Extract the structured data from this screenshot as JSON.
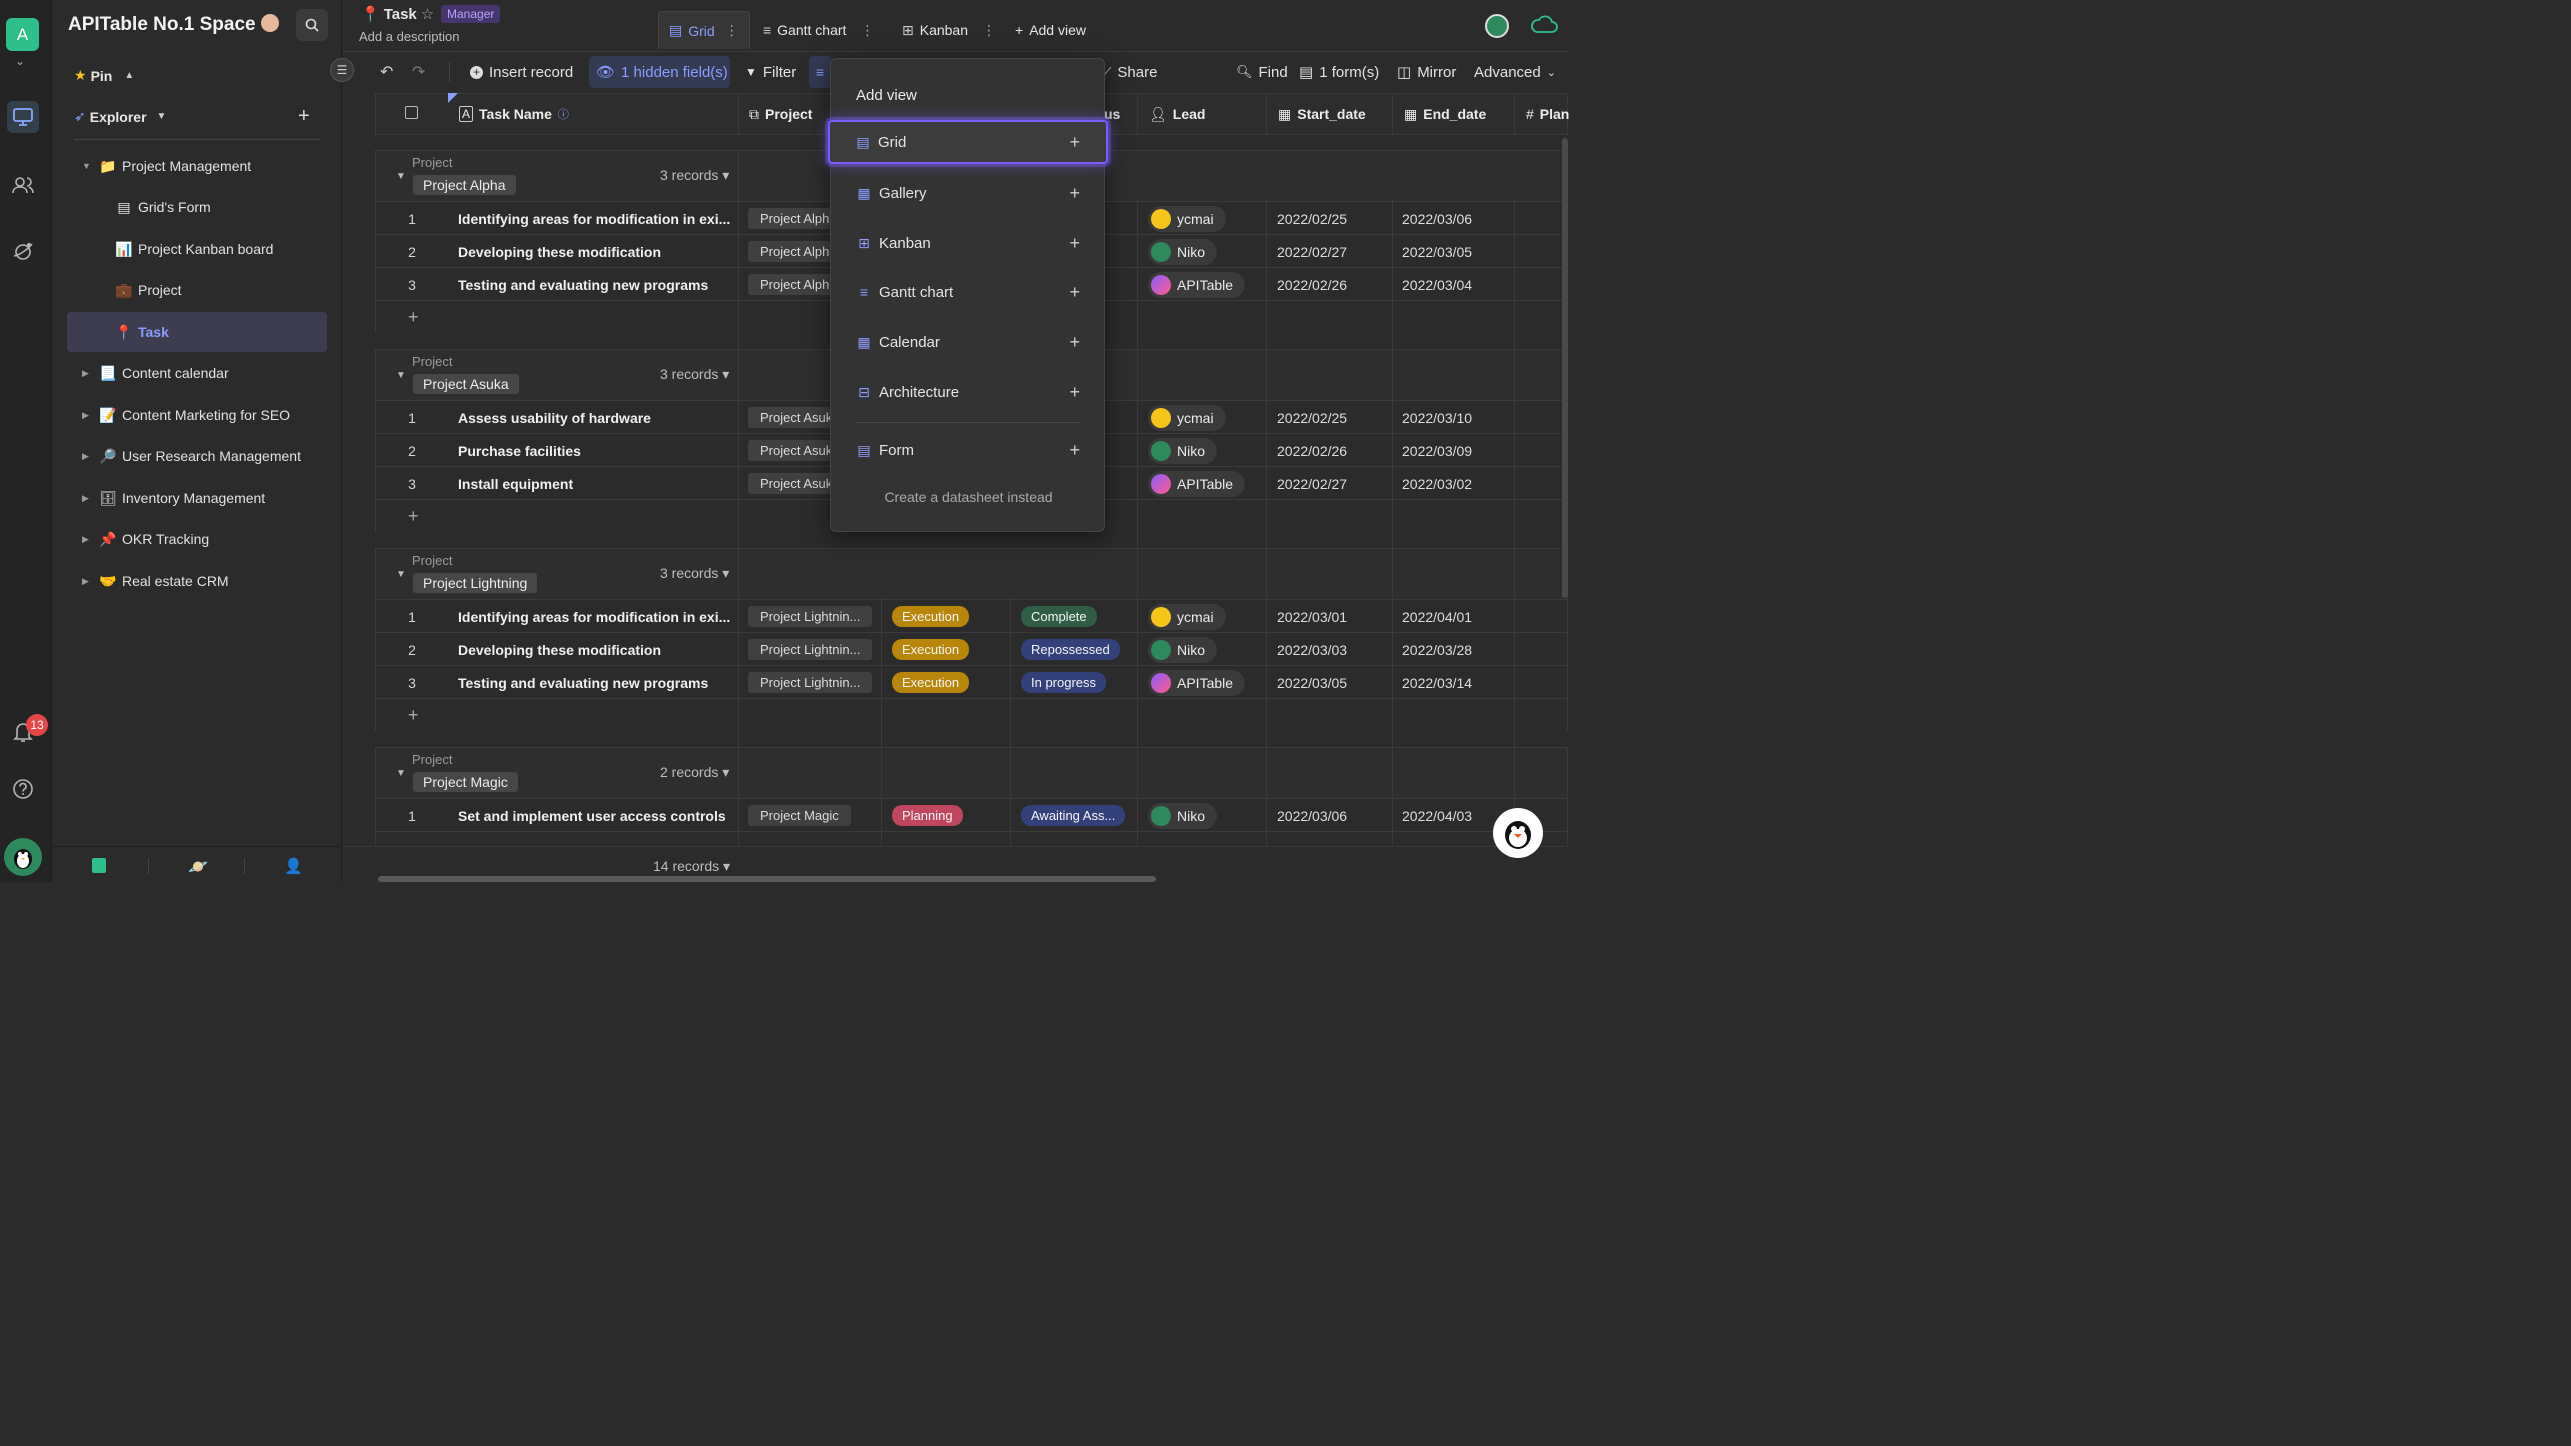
{
  "space": {
    "avatar_letter": "A",
    "name": "APITable No.1 Space",
    "notification_count": "13"
  },
  "sidebar": {
    "pin_label": "Pin",
    "explorer_label": "Explorer",
    "items": [
      {
        "label": "Project Management",
        "icon": "📁"
      },
      {
        "label": "Grid's Form",
        "icon": "▤"
      },
      {
        "label": "Project Kanban board",
        "icon": "📊"
      },
      {
        "label": "Project",
        "icon": "💼"
      },
      {
        "label": "Task",
        "icon": "📍"
      },
      {
        "label": "Content calendar",
        "icon": "📃"
      },
      {
        "label": "Content Marketing for SEO",
        "icon": "📝"
      },
      {
        "label": "User Research Management",
        "icon": "🔎"
      },
      {
        "label": "Inventory Management",
        "icon": "🗄"
      },
      {
        "label": "OKR Tracking",
        "icon": "📌"
      },
      {
        "label": "Real estate CRM",
        "icon": "🤝"
      }
    ]
  },
  "datasheet": {
    "title": "Task",
    "role": "Manager",
    "description": "Add a description",
    "views": [
      {
        "label": "Grid"
      },
      {
        "label": "Gantt chart"
      },
      {
        "label": "Kanban"
      }
    ],
    "add_view_label": "Add view"
  },
  "toolbar": {
    "insert_record": "Insert record",
    "hidden_fields": "1 hidden field(s)",
    "filter": "Filter",
    "share": "Share",
    "find": "Find",
    "forms": "1 form(s)",
    "mirror": "Mirror",
    "advanced": "Advanced"
  },
  "columns": {
    "task_name": "Task Name",
    "project": "Project",
    "status_partial": "us",
    "lead": "Lead",
    "start_date": "Start_date",
    "end_date": "End_date",
    "plan_partial": "Plan"
  },
  "groups": [
    {
      "label": "Project",
      "name": "Project Alpha",
      "count": "3 records",
      "rows": [
        {
          "n": "1",
          "task": "Identifying areas for modification in exi...",
          "project": "Project Alph",
          "phase": "",
          "status": "",
          "lead": "ycmai",
          "start": "2022/02/25",
          "end": "2022/03/06"
        },
        {
          "n": "2",
          "task": "Developing these modification",
          "project": "Project Alph",
          "phase": "",
          "status": "",
          "lead": "Niko",
          "start": "2022/02/27",
          "end": "2022/03/05"
        },
        {
          "n": "3",
          "task": "Testing and evaluating new programs",
          "project": "Project Alph",
          "phase": "",
          "status": "",
          "lead": "APITable",
          "start": "2022/02/26",
          "end": "2022/03/04"
        }
      ]
    },
    {
      "label": "Project",
      "name": "Project Asuka",
      "count": "3 records",
      "rows": [
        {
          "n": "1",
          "task": "Assess usability of hardware",
          "project": "Project Asuk",
          "phase": "",
          "status": "",
          "lead": "ycmai",
          "start": "2022/02/25",
          "end": "2022/03/10"
        },
        {
          "n": "2",
          "task": "Purchase facilities",
          "project": "Project Asuk",
          "phase": "",
          "status": "",
          "lead": "Niko",
          "start": "2022/02/26",
          "end": "2022/03/09"
        },
        {
          "n": "3",
          "task": "Install equipment",
          "project": "Project Asuk",
          "phase": "",
          "status": "",
          "lead": "APITable",
          "start": "2022/02/27",
          "end": "2022/03/02"
        }
      ]
    },
    {
      "label": "Project",
      "name": "Project Lightning",
      "count": "3 records",
      "rows": [
        {
          "n": "1",
          "task": "Identifying areas for modification in exi...",
          "project": "Project Lightnin...",
          "phase": "Execution",
          "status": "Complete",
          "lead": "ycmai",
          "start": "2022/03/01",
          "end": "2022/04/01"
        },
        {
          "n": "2",
          "task": "Developing these modification",
          "project": "Project Lightnin...",
          "phase": "Execution",
          "status": "Repossessed",
          "lead": "Niko",
          "start": "2022/03/03",
          "end": "2022/03/28"
        },
        {
          "n": "3",
          "task": "Testing and evaluating new programs",
          "project": "Project Lightnin...",
          "phase": "Execution",
          "status": "In progress",
          "lead": "APITable",
          "start": "2022/03/05",
          "end": "2022/03/14"
        }
      ]
    },
    {
      "label": "Project",
      "name": "Project Magic",
      "count": "2 records",
      "rows": [
        {
          "n": "1",
          "task": "Set and implement user access controls",
          "project": "Project Magic",
          "phase": "Planning",
          "status": "Awaiting Ass...",
          "lead": "Niko",
          "start": "2022/03/06",
          "end": "2022/04/03"
        }
      ]
    }
  ],
  "footer": {
    "records": "14 records"
  },
  "add_view_menu": {
    "title": "Add view",
    "items": [
      {
        "label": "Grid",
        "icon": "grid-icon"
      },
      {
        "label": "Gallery",
        "icon": "gallery-icon"
      },
      {
        "label": "Kanban",
        "icon": "kanban-icon"
      },
      {
        "label": "Gantt chart",
        "icon": "gantt-icon"
      },
      {
        "label": "Calendar",
        "icon": "calendar-icon"
      },
      {
        "label": "Architecture",
        "icon": "architecture-icon"
      },
      {
        "label": "Form",
        "icon": "form-icon"
      }
    ],
    "footer": "Create a datasheet instead"
  },
  "colors": {
    "accent": "#8b9dff",
    "highlight": "#7b5cff",
    "execution": "#b8860b",
    "planning": "#c0455f",
    "status_complete": "#2f5d46",
    "status_other": "#34407a"
  }
}
